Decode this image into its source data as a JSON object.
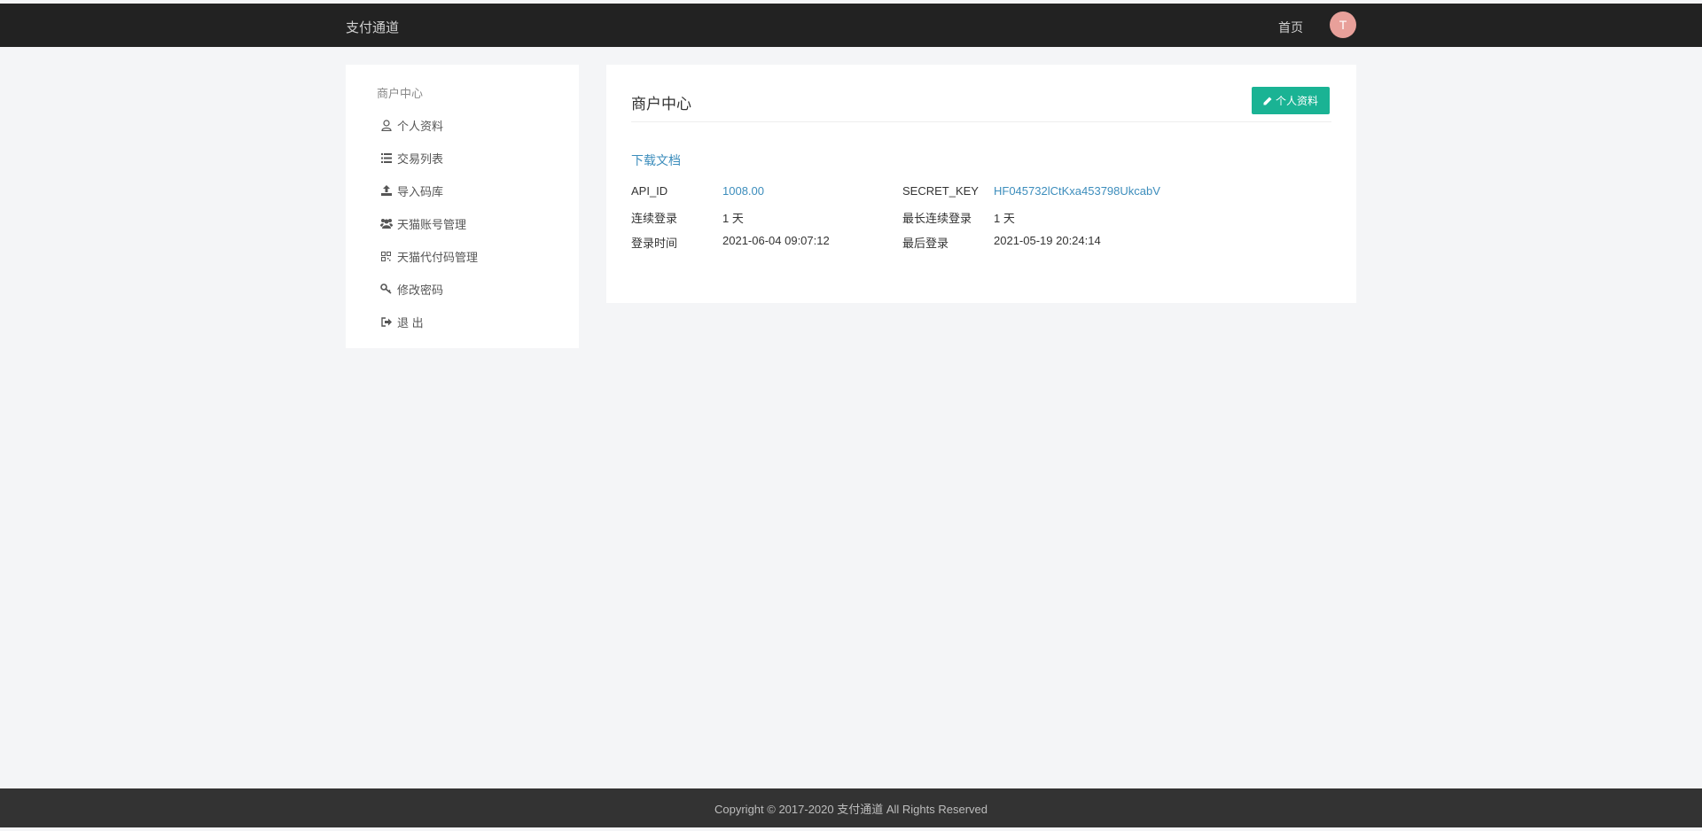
{
  "header": {
    "brand": "支付通道",
    "home_label": "首页",
    "avatar_letter": "T"
  },
  "sidebar": {
    "title": "商户中心",
    "items": [
      {
        "label": "个人资料",
        "icon": "user-icon"
      },
      {
        "label": "交易列表",
        "icon": "list-icon"
      },
      {
        "label": "导入码库",
        "icon": "upload-icon"
      },
      {
        "label": "天猫账号管理",
        "icon": "users-icon"
      },
      {
        "label": "天猫代付码管理",
        "icon": "qrcode-icon"
      },
      {
        "label": "修改密码",
        "icon": "key-icon"
      },
      {
        "label": "退 出",
        "icon": "sign-out-icon"
      }
    ]
  },
  "main": {
    "title": "商户中心",
    "edit_button_label": "个人资料",
    "doc_link": "下载文档",
    "info": {
      "api_id_label": "API_ID",
      "api_id_value": "1008.00",
      "secret_key_label": "SECRET_KEY",
      "secret_key_value": "HF045732lCtKxa453798UkcabV",
      "continuous_login_label": "连续登录",
      "continuous_login_value": "1 天",
      "longest_login_label": "最长连续登录",
      "longest_login_value": "1 天",
      "login_time_label": "登录时间",
      "login_time_value": "2021-06-04 09:07:12",
      "last_login_label": "最后登录",
      "last_login_value": "2021-05-19 20:24:14"
    }
  },
  "footer": {
    "copyright": "Copyright © 2017-2020 支付通道 All Rights Reserved"
  },
  "colors": {
    "topbar": "#222222",
    "accent": "#1ab394",
    "link": "#3c8dbc",
    "avatar": "#e8a09a",
    "footer": "#333333"
  }
}
